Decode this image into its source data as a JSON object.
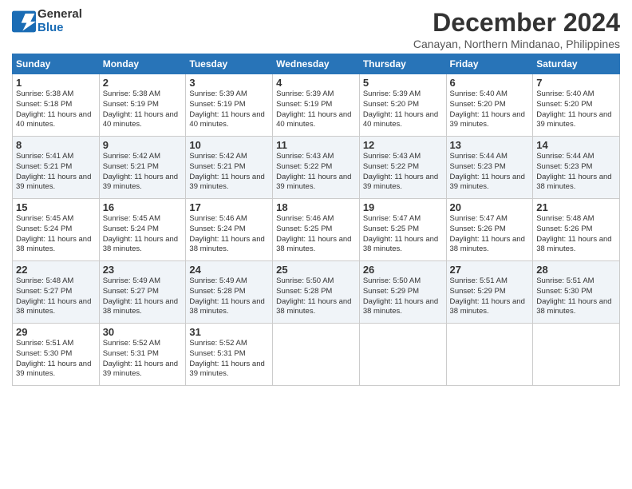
{
  "header": {
    "logo_line1": "General",
    "logo_line2": "Blue",
    "month": "December 2024",
    "location": "Canayan, Northern Mindanao, Philippines"
  },
  "weekdays": [
    "Sunday",
    "Monday",
    "Tuesday",
    "Wednesday",
    "Thursday",
    "Friday",
    "Saturday"
  ],
  "weeks": [
    [
      {
        "day": "1",
        "sr": "5:38 AM",
        "ss": "5:18 PM",
        "dl": "11 hours and 40 minutes."
      },
      {
        "day": "2",
        "sr": "5:38 AM",
        "ss": "5:19 PM",
        "dl": "11 hours and 40 minutes."
      },
      {
        "day": "3",
        "sr": "5:39 AM",
        "ss": "5:19 PM",
        "dl": "11 hours and 40 minutes."
      },
      {
        "day": "4",
        "sr": "5:39 AM",
        "ss": "5:19 PM",
        "dl": "11 hours and 40 minutes."
      },
      {
        "day": "5",
        "sr": "5:39 AM",
        "ss": "5:20 PM",
        "dl": "11 hours and 40 minutes."
      },
      {
        "day": "6",
        "sr": "5:40 AM",
        "ss": "5:20 PM",
        "dl": "11 hours and 39 minutes."
      },
      {
        "day": "7",
        "sr": "5:40 AM",
        "ss": "5:20 PM",
        "dl": "11 hours and 39 minutes."
      }
    ],
    [
      {
        "day": "8",
        "sr": "5:41 AM",
        "ss": "5:21 PM",
        "dl": "11 hours and 39 minutes."
      },
      {
        "day": "9",
        "sr": "5:42 AM",
        "ss": "5:21 PM",
        "dl": "11 hours and 39 minutes."
      },
      {
        "day": "10",
        "sr": "5:42 AM",
        "ss": "5:21 PM",
        "dl": "11 hours and 39 minutes."
      },
      {
        "day": "11",
        "sr": "5:43 AM",
        "ss": "5:22 PM",
        "dl": "11 hours and 39 minutes."
      },
      {
        "day": "12",
        "sr": "5:43 AM",
        "ss": "5:22 PM",
        "dl": "11 hours and 39 minutes."
      },
      {
        "day": "13",
        "sr": "5:44 AM",
        "ss": "5:23 PM",
        "dl": "11 hours and 39 minutes."
      },
      {
        "day": "14",
        "sr": "5:44 AM",
        "ss": "5:23 PM",
        "dl": "11 hours and 38 minutes."
      }
    ],
    [
      {
        "day": "15",
        "sr": "5:45 AM",
        "ss": "5:24 PM",
        "dl": "11 hours and 38 minutes."
      },
      {
        "day": "16",
        "sr": "5:45 AM",
        "ss": "5:24 PM",
        "dl": "11 hours and 38 minutes."
      },
      {
        "day": "17",
        "sr": "5:46 AM",
        "ss": "5:24 PM",
        "dl": "11 hours and 38 minutes."
      },
      {
        "day": "18",
        "sr": "5:46 AM",
        "ss": "5:25 PM",
        "dl": "11 hours and 38 minutes."
      },
      {
        "day": "19",
        "sr": "5:47 AM",
        "ss": "5:25 PM",
        "dl": "11 hours and 38 minutes."
      },
      {
        "day": "20",
        "sr": "5:47 AM",
        "ss": "5:26 PM",
        "dl": "11 hours and 38 minutes."
      },
      {
        "day": "21",
        "sr": "5:48 AM",
        "ss": "5:26 PM",
        "dl": "11 hours and 38 minutes."
      }
    ],
    [
      {
        "day": "22",
        "sr": "5:48 AM",
        "ss": "5:27 PM",
        "dl": "11 hours and 38 minutes."
      },
      {
        "day": "23",
        "sr": "5:49 AM",
        "ss": "5:27 PM",
        "dl": "11 hours and 38 minutes."
      },
      {
        "day": "24",
        "sr": "5:49 AM",
        "ss": "5:28 PM",
        "dl": "11 hours and 38 minutes."
      },
      {
        "day": "25",
        "sr": "5:50 AM",
        "ss": "5:28 PM",
        "dl": "11 hours and 38 minutes."
      },
      {
        "day": "26",
        "sr": "5:50 AM",
        "ss": "5:29 PM",
        "dl": "11 hours and 38 minutes."
      },
      {
        "day": "27",
        "sr": "5:51 AM",
        "ss": "5:29 PM",
        "dl": "11 hours and 38 minutes."
      },
      {
        "day": "28",
        "sr": "5:51 AM",
        "ss": "5:30 PM",
        "dl": "11 hours and 38 minutes."
      }
    ],
    [
      {
        "day": "29",
        "sr": "5:51 AM",
        "ss": "5:30 PM",
        "dl": "11 hours and 39 minutes."
      },
      {
        "day": "30",
        "sr": "5:52 AM",
        "ss": "5:31 PM",
        "dl": "11 hours and 39 minutes."
      },
      {
        "day": "31",
        "sr": "5:52 AM",
        "ss": "5:31 PM",
        "dl": "11 hours and 39 minutes."
      },
      null,
      null,
      null,
      null
    ]
  ]
}
